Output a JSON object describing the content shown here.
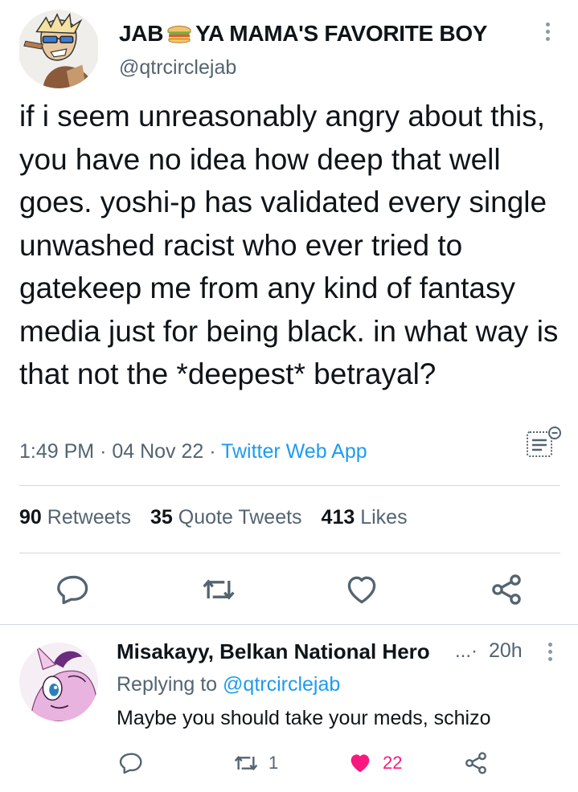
{
  "tweet": {
    "name_part1": "JAB",
    "name_emoji": "sandwich-icon",
    "name_part2": "YA MAMA'S FAVORITE BOY",
    "handle": "@qtrcirclejab",
    "text": "if i seem unreasonably angry about this, you have no idea how deep that well goes. yoshi-p has validated every single unwashed racist who ever tried to gatekeep me from any kind of fantasy media just for being black. in what way is that not the *deepest* betrayal?",
    "time": "1:49 PM",
    "date": "04 Nov 22",
    "source": "Twitter Web App",
    "separator": "·",
    "stats": {
      "retweets_count": "90",
      "retweets_label": "Retweets",
      "quotes_count": "35",
      "quotes_label": "Quote Tweets",
      "likes_count": "413",
      "likes_label": "Likes"
    }
  },
  "reply": {
    "name": "Misakayy, Belkan National Hero",
    "name_ellipsis": "...",
    "separator": "·",
    "time": "20h",
    "replying_prefix": "Replying to",
    "replying_to": "@qtrcirclejab",
    "text": "Maybe you should take your meds, schizo",
    "retweet_count": "1",
    "like_count": "22"
  },
  "colors": {
    "accent": "#1d9bf0",
    "like": "#f91880",
    "secondary_text": "#536471",
    "divider": "#cfd9de"
  },
  "icons": [
    "more-vertical-icon",
    "analytics-icon",
    "reply-icon",
    "retweet-icon",
    "like-icon",
    "share-icon",
    "liked-heart-icon"
  ]
}
